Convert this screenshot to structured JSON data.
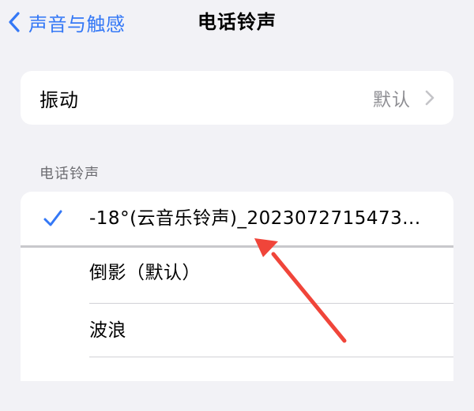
{
  "nav": {
    "back_label": "声音与触感",
    "title": "电话铃声"
  },
  "vibration": {
    "label": "振动",
    "value": "默认"
  },
  "ringtones": {
    "section_header": "电话铃声",
    "items": [
      {
        "label": "-18°(云音乐铃声)_2023072715473...",
        "selected": true
      },
      {
        "label": "倒影（默认）",
        "selected": false
      },
      {
        "label": "波浪",
        "selected": false
      },
      {
        "label": "",
        "selected": false
      }
    ]
  },
  "colors": {
    "accent": "#3478f6",
    "background": "#f2f2f6",
    "annotation_arrow": "#f0453a"
  }
}
